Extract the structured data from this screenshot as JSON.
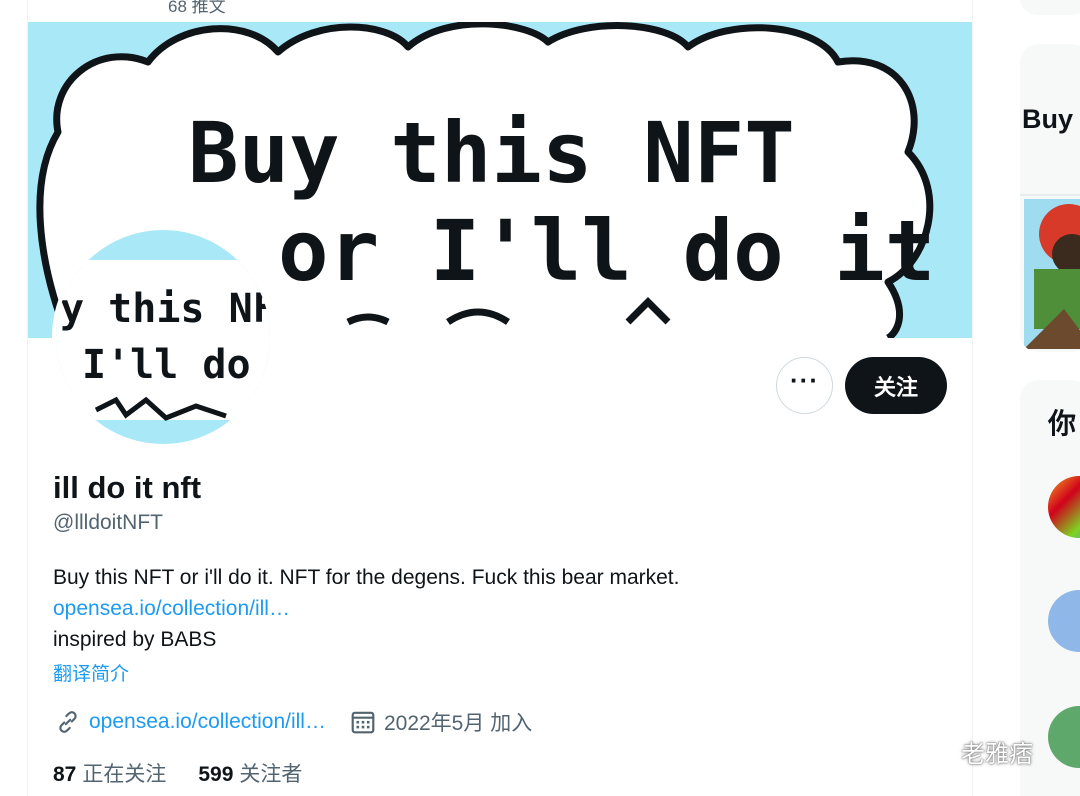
{
  "header": {
    "tweet_count": "68 推文"
  },
  "banner": {
    "line1": "Buy this NFT",
    "line2": "or I'll do it"
  },
  "avatar": {
    "line1": "y this NFT",
    "line2": "I'll do"
  },
  "actions": {
    "more_icon": "more-horizontal-icon",
    "more_label": "···",
    "follow_label": "关注"
  },
  "profile": {
    "display_name": "ill do it nft",
    "handle": "@llldoitNFT",
    "bio_text": "Buy this NFT or i'll do it. NFT for the degens. Fuck this bear market.",
    "bio_link": "opensea.io/collection/ill…",
    "bio_extra": "inspired by BABS",
    "translate_label": "翻译简介"
  },
  "meta": {
    "link_icon": "link-icon",
    "link": "opensea.io/collection/ill…",
    "calendar_icon": "calendar-icon",
    "joined": "2022年5月 加入"
  },
  "stats": {
    "following_count": "87",
    "following_label": "正在关注",
    "followers_count": "599",
    "followers_label": "关注者"
  },
  "sidebar": {
    "card_title": "Buy",
    "who_title": "你"
  },
  "watermark": {
    "icon": "wechat-icon",
    "text": "老雅痞"
  },
  "colors": {
    "accent": "#1d9bf0",
    "banner_bg": "#a9e8f6",
    "text": "#0f1419",
    "muted": "#536471"
  }
}
